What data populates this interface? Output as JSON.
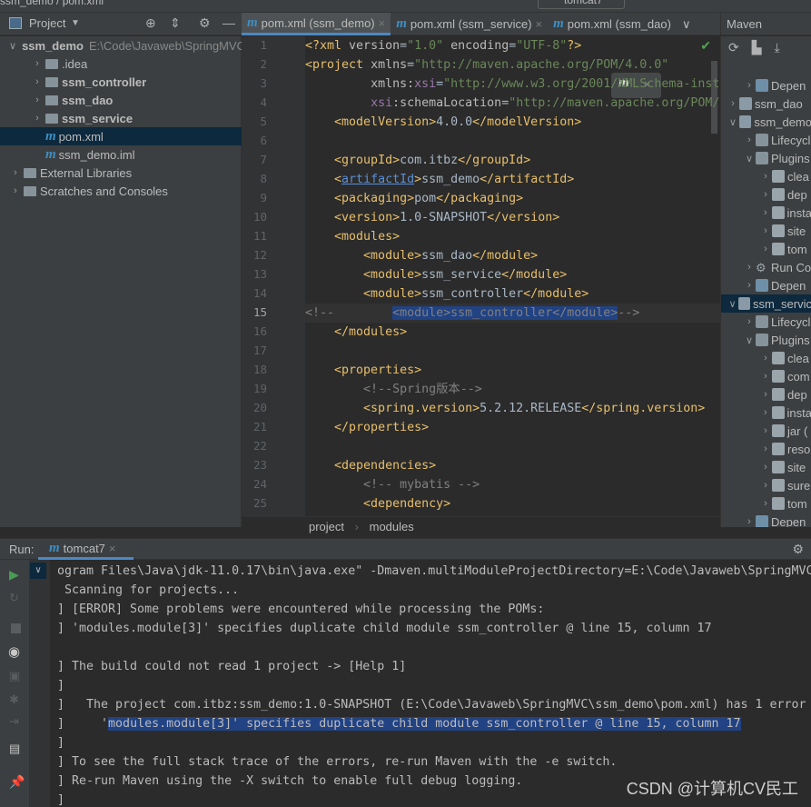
{
  "titlebar": {
    "crumb": "ssm_demo / pom.xml",
    "run_config": "tomcat7"
  },
  "project_panel": {
    "title": "Project",
    "tree": [
      {
        "label": "ssm_demo",
        "path": "E:\\Code\\Javaweb\\SpringMVC",
        "level": 0,
        "expanded": true,
        "bold": true
      },
      {
        "label": ".idea",
        "level": 1,
        "bold": false
      },
      {
        "label": "ssm_controller",
        "level": 1,
        "bold": true
      },
      {
        "label": "ssm_dao",
        "level": 1,
        "bold": true
      },
      {
        "label": "ssm_service",
        "level": 1,
        "bold": true
      },
      {
        "label": "pom.xml",
        "level": 1,
        "file": true,
        "selected": true
      },
      {
        "label": "ssm_demo.iml",
        "level": 1,
        "file": true
      },
      {
        "label": "External Libraries",
        "level": 0
      },
      {
        "label": "Scratches and Consoles",
        "level": 0
      }
    ]
  },
  "tabs": [
    {
      "label": "pom.xml (ssm_demo)",
      "active": true
    },
    {
      "label": "pom.xml (ssm_service)",
      "active": false
    },
    {
      "label": "pom.xml (ssm_dao)",
      "active": false
    }
  ],
  "editor": {
    "current_line": 15,
    "lines": [
      [
        [
          "tg",
          "<?xml "
        ],
        [
          "at",
          "version"
        ],
        [
          "tx",
          "="
        ],
        [
          "st",
          "\"1.0\" "
        ],
        [
          "at",
          "encoding"
        ],
        [
          "tx",
          "="
        ],
        [
          "st",
          "\"UTF-8\""
        ],
        [
          "tg",
          "?>"
        ]
      ],
      [
        [
          "tg",
          "<project "
        ],
        [
          "at",
          "xmlns"
        ],
        [
          "tx",
          "="
        ],
        [
          "st",
          "\"http://maven.apache.org/POM/4.0.0\""
        ]
      ],
      [
        [
          "tx",
          "         "
        ],
        [
          "at",
          "xmlns:"
        ],
        [
          "ns",
          "xsi"
        ],
        [
          "tx",
          "="
        ],
        [
          "st",
          "\"http://www.w3.org/2001/XMLSchema-inst"
        ]
      ],
      [
        [
          "tx",
          "         "
        ],
        [
          "ns",
          "xsi"
        ],
        [
          "at",
          ":schemaLocation"
        ],
        [
          "tx",
          "="
        ],
        [
          "st",
          "\"http://maven.apache.org/POM/"
        ]
      ],
      [
        [
          "tx",
          "    "
        ],
        [
          "tg",
          "<modelVersion>"
        ],
        [
          "tx",
          "4.0.0"
        ],
        [
          "tg",
          "</modelVersion>"
        ]
      ],
      [],
      [
        [
          "tx",
          "    "
        ],
        [
          "tg",
          "<groupId>"
        ],
        [
          "tx",
          "com.itbz"
        ],
        [
          "tg",
          "</groupId>"
        ]
      ],
      [
        [
          "tx",
          "    "
        ],
        [
          "tg",
          "<"
        ],
        [
          "ul",
          "artifactId"
        ],
        [
          "tg",
          ">"
        ],
        [
          "tx",
          "ssm_demo"
        ],
        [
          "tg",
          "</artifactId>"
        ]
      ],
      [
        [
          "tx",
          "    "
        ],
        [
          "tg",
          "<packaging>"
        ],
        [
          "tx",
          "pom"
        ],
        [
          "tg",
          "</packaging>"
        ]
      ],
      [
        [
          "tx",
          "    "
        ],
        [
          "tg",
          "<version>"
        ],
        [
          "tx",
          "1.0-SNAPSHOT"
        ],
        [
          "tg",
          "</version>"
        ]
      ],
      [
        [
          "tx",
          "    "
        ],
        [
          "tg",
          "<modules>"
        ]
      ],
      [
        [
          "tx",
          "        "
        ],
        [
          "tg",
          "<module>"
        ],
        [
          "tx",
          "ssm_dao"
        ],
        [
          "tg",
          "</module>"
        ]
      ],
      [
        [
          "tx",
          "        "
        ],
        [
          "tg",
          "<module>"
        ],
        [
          "tx",
          "ssm_service"
        ],
        [
          "tg",
          "</module>"
        ]
      ],
      [
        [
          "tx",
          "        "
        ],
        [
          "tg",
          "<module>"
        ],
        [
          "tx",
          "ssm_controller"
        ],
        [
          "tg",
          "</module>"
        ]
      ],
      [
        [
          "cm",
          "<!--        "
        ],
        [
          "cm hl",
          "<module>ssm_controller</module>"
        ],
        [
          "cm",
          "-->"
        ]
      ],
      [
        [
          "tx",
          "    "
        ],
        [
          "tg",
          "</modules>"
        ]
      ],
      [],
      [
        [
          "tx",
          "    "
        ],
        [
          "tg",
          "<properties>"
        ]
      ],
      [
        [
          "tx",
          "        "
        ],
        [
          "cm",
          "<!--Spring版本-->"
        ]
      ],
      [
        [
          "tx",
          "        "
        ],
        [
          "tg",
          "<spring.version>"
        ],
        [
          "tx",
          "5.2.12.RELEASE"
        ],
        [
          "tg",
          "</spring.version>"
        ]
      ],
      [
        [
          "tx",
          "    "
        ],
        [
          "tg",
          "</properties>"
        ]
      ],
      [],
      [
        [
          "tx",
          "    "
        ],
        [
          "tg",
          "<dependencies>"
        ]
      ],
      [
        [
          "tx",
          "        "
        ],
        [
          "cm",
          "<!-- mybatis -->"
        ]
      ],
      [
        [
          "tx",
          "        "
        ],
        [
          "tg",
          "<dependency>"
        ]
      ]
    ]
  },
  "breadcrumb": [
    "project",
    "modules"
  ],
  "maven_panel": {
    "title": "Maven",
    "tree": [
      {
        "label": "Depen",
        "level": 2,
        "icon": "deps"
      },
      {
        "label": "ssm_dao",
        "level": 1,
        "icon": "module"
      },
      {
        "label": "ssm_demo",
        "level": 1,
        "icon": "module",
        "expanded": true
      },
      {
        "label": "Lifecycl",
        "level": 2,
        "icon": "folder"
      },
      {
        "label": "Plugins",
        "level": 2,
        "icon": "folder",
        "expanded": true
      },
      {
        "label": "clea",
        "level": 3,
        "icon": "plugin"
      },
      {
        "label": "dep",
        "level": 3,
        "icon": "plugin"
      },
      {
        "label": "insta",
        "level": 3,
        "icon": "plugin"
      },
      {
        "label": "site",
        "level": 3,
        "icon": "plugin"
      },
      {
        "label": "tom",
        "level": 3,
        "icon": "plugin"
      },
      {
        "label": "Run Co",
        "level": 2,
        "icon": "gear"
      },
      {
        "label": "Depen",
        "level": 2,
        "icon": "deps"
      },
      {
        "label": "ssm_servic",
        "level": 1,
        "icon": "module",
        "expanded": true,
        "selected": true
      },
      {
        "label": "Lifecycl",
        "level": 2,
        "icon": "folder"
      },
      {
        "label": "Plugins",
        "level": 2,
        "icon": "folder",
        "expanded": true
      },
      {
        "label": "clea",
        "level": 3,
        "icon": "plugin"
      },
      {
        "label": "com",
        "level": 3,
        "icon": "plugin"
      },
      {
        "label": "dep",
        "level": 3,
        "icon": "plugin"
      },
      {
        "label": "insta",
        "level": 3,
        "icon": "plugin"
      },
      {
        "label": "jar (",
        "level": 3,
        "icon": "plugin"
      },
      {
        "label": "reso",
        "level": 3,
        "icon": "plugin"
      },
      {
        "label": "site",
        "level": 3,
        "icon": "plugin"
      },
      {
        "label": "sure",
        "level": 3,
        "icon": "plugin"
      },
      {
        "label": "tom",
        "level": 3,
        "icon": "plugin"
      },
      {
        "label": "Depen",
        "level": 2,
        "icon": "deps"
      }
    ]
  },
  "run": {
    "label": "Run:",
    "tab": "tomcat7",
    "console": [
      {
        "text": "ogram Files\\Java\\jdk-11.0.17\\bin\\java.exe\" -Dmaven.multiModuleProjectDirectory=E:\\Code\\Javaweb\\SpringMVC"
      },
      {
        "text": " Scanning for projects..."
      },
      {
        "text": "] [ERROR] Some problems were encountered while processing the POMs:"
      },
      {
        "text": "] 'modules.module[3]' specifies duplicate child module ssm_controller @ line 15, column 17"
      },
      {
        "text": ""
      },
      {
        "text": "] The build could not read 1 project -> [Help 1]"
      },
      {
        "text": "]"
      },
      {
        "text": "]   The project com.itbz:ssm_demo:1.0-SNAPSHOT (E:\\Code\\Javaweb\\SpringMVC\\ssm_demo\\pom.xml) has 1 error"
      },
      {
        "text": "]     '",
        "hl": "modules.module[3]' specifies duplicate child module ssm_controller @ line 15, column 17"
      },
      {
        "text": "]"
      },
      {
        "text": "] To see the full stack trace of the errors, re-run Maven with the -e switch."
      },
      {
        "text": "] Re-run Maven using the -X switch to enable full debug logging."
      },
      {
        "text": "]"
      }
    ]
  },
  "watermark": "CSDN @计算机CV民工",
  "colors": {
    "accent": "#4a88c7",
    "selection": "#214283",
    "tag": "#e8bf6a",
    "string": "#6a8759"
  }
}
